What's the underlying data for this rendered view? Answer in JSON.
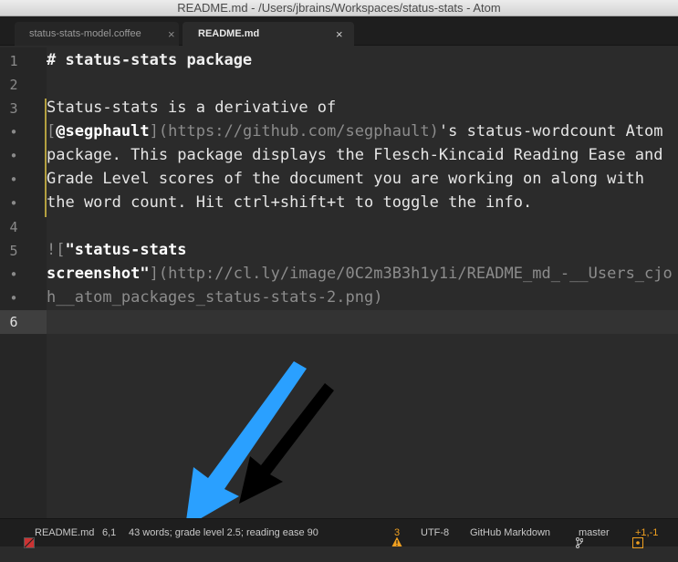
{
  "window": {
    "title": "README.md - /Users/jbrains/Workspaces/status-stats - Atom"
  },
  "tabs": [
    {
      "label": "status-stats-model.coffee",
      "close": "×"
    },
    {
      "label": "README.md",
      "close": "×"
    }
  ],
  "gutter": [
    "1",
    "2",
    "3",
    "•",
    "•",
    "•",
    "4",
    "5",
    "•",
    "•",
    "6"
  ],
  "editor": {
    "line1": "# status-stats package",
    "line3": "Status-stats is a derivative of",
    "line3b_open": "[",
    "line3b_bold": "@segphault",
    "line3b_link": "](https://github.com/segphault)",
    "line3b_rest": "'s status-wordcount Atom",
    "line3c": "package. This package displays the Flesch-Kincaid Reading Ease and",
    "line3d": "Grade Level scores of the document you are working on along with",
    "line3e": "the word count. Hit ctrl+shift+t to toggle the info.",
    "line5_open": "![",
    "line5_bold": "\"status-stats",
    "line5b_bold": "screenshot\"",
    "line5b_link": "](http://cl.ly/image/0C2m3B3h1y1i/README_md_-__Users_cjo",
    "line5c_link": "h__atom_packages_status-stats-2.png)"
  },
  "statusbar": {
    "file": "README.md",
    "cursor": "6,1",
    "stats": "43 words; grade level 2.5; reading ease 90",
    "warnings": "3",
    "encoding": "UTF-8",
    "grammar": "GitHub Markdown",
    "branch": "master",
    "diff": "+1,-1"
  },
  "colors": {
    "arrow_blue": "#2aa0ff",
    "arrow_black": "#000000",
    "accent_orange": "#f0a020"
  }
}
